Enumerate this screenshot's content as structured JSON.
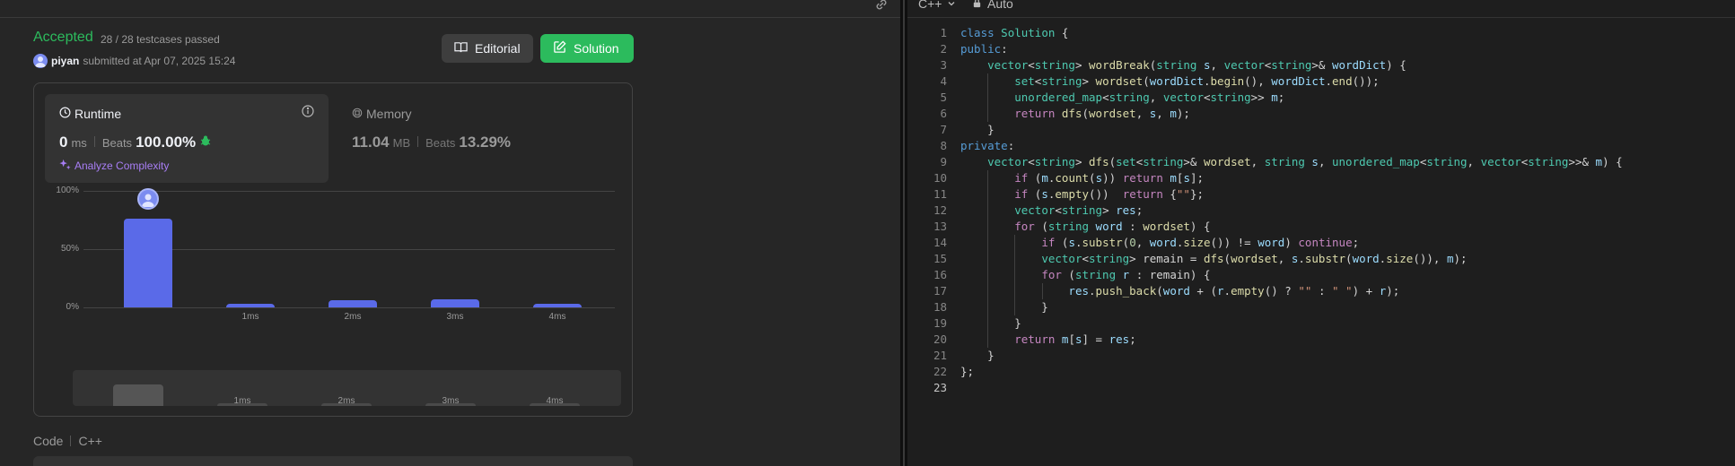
{
  "submission": {
    "status": "Accepted",
    "testcases": "28 / 28 testcases passed",
    "user": "piyan",
    "submitted_text": "submitted at Apr 07, 2025 15:24"
  },
  "buttons": {
    "editorial": "Editorial",
    "solution": "Solution"
  },
  "runtime": {
    "title": "Runtime",
    "value": "0",
    "unit": "ms",
    "beats_label": "Beats",
    "beats_value": "100.00%",
    "analyze": "Analyze Complexity"
  },
  "memory": {
    "title": "Memory",
    "value": "11.04",
    "unit": "MB",
    "beats_label": "Beats",
    "beats_value": "13.29%"
  },
  "chart_data": {
    "type": "bar",
    "categories": [
      "0ms",
      "1ms",
      "2ms",
      "3ms",
      "4ms"
    ],
    "x_tick_labels": [
      "",
      "1ms",
      "2ms",
      "3ms",
      "4ms"
    ],
    "values": [
      76,
      3,
      6,
      7,
      3
    ],
    "y_ticks": [
      "100%",
      "50%",
      "0%"
    ],
    "ylim": [
      0,
      100
    ],
    "highlight_index": 0,
    "minimap_values": [
      60,
      8,
      8,
      8,
      8
    ],
    "grid": true,
    "color": "#5a6ae8"
  },
  "code_section": {
    "label": "Code",
    "language": "C++"
  },
  "editor": {
    "language": "C++",
    "mode": "Auto",
    "lines": [
      "class Solution {",
      "public:",
      "    vector<string> wordBreak(string s, vector<string>& wordDict) {",
      "        set<string> wordset(wordDict.begin(), wordDict.end());",
      "        unordered_map<string, vector<string>> m;",
      "        return dfs(wordset, s, m);",
      "    }",
      "private:",
      "    vector<string> dfs(set<string>& wordset, string s, unordered_map<string, vector<string>>& m) {",
      "        if (m.count(s)) return m[s];",
      "        if (s.empty())  return {\"\"};",
      "        vector<string> res;",
      "        for (string word : wordset) {",
      "            if (s.substr(0, word.size()) != word) continue;",
      "            vector<string> remain = dfs(wordset, s.substr(word.size()), m);",
      "            for (string r : remain) {",
      "                res.push_back(word + (r.empty() ? \"\" : \" \") + r);",
      "            }",
      "        }",
      "        return m[s] = res;",
      "    }",
      "};",
      ""
    ]
  },
  "colors": {
    "accepted": "#2cbb5d",
    "bar": "#5a6ae8",
    "analyze": "#a87ef5"
  }
}
